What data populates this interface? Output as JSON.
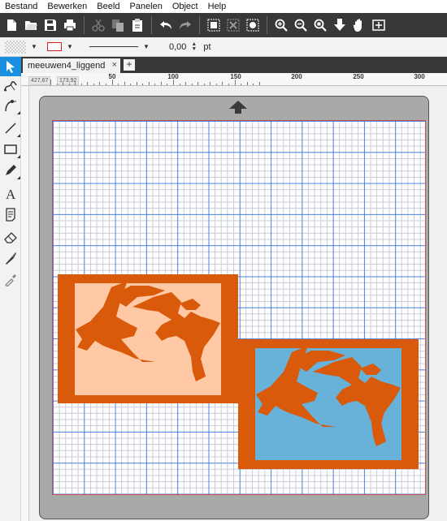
{
  "menubar": {
    "items": [
      "Bestand",
      "Bewerken",
      "Beeld",
      "Panelen",
      "Object",
      "Help"
    ]
  },
  "toolbar": {
    "buttons": [
      {
        "icon": "new-document-icon"
      },
      {
        "icon": "open-folder-icon"
      },
      {
        "icon": "save-icon"
      },
      {
        "icon": "print-icon"
      },
      {
        "icon": "cut-icon"
      },
      {
        "icon": "copy-icon"
      },
      {
        "icon": "paste-icon"
      },
      {
        "icon": "undo-icon"
      },
      {
        "icon": "redo-icon"
      },
      {
        "icon": "group-icon"
      },
      {
        "icon": "ungroup-icon"
      },
      {
        "icon": "trace-image-icon"
      },
      {
        "icon": "zoom-in-icon"
      },
      {
        "icon": "zoom-out-icon"
      },
      {
        "icon": "zoom-selection-icon"
      },
      {
        "icon": "send-to-cutter-icon"
      },
      {
        "icon": "pan-hand-icon"
      },
      {
        "icon": "fit-page-icon"
      }
    ],
    "colors": {
      "background": "#383838",
      "icon": "#ffffff"
    }
  },
  "options": {
    "stroke_width": "0,00",
    "unit": "pt",
    "stroke_color": "#e02020"
  },
  "document": {
    "tab_label": "meeuwen4_liggend",
    "close_glyph": "×",
    "add_glyph": "+"
  },
  "ruler": {
    "labels": [
      "50",
      "100",
      "150",
      "200",
      "250",
      "300"
    ],
    "cursor_x": "427,67",
    "cursor_y": "173,92"
  },
  "tools": [
    {
      "icon": "select-arrow-icon",
      "active": true
    },
    {
      "icon": "node-edit-icon"
    },
    {
      "icon": "bezier-pen-icon"
    },
    {
      "icon": "line-tool-icon"
    },
    {
      "icon": "rectangle-tool-icon"
    },
    {
      "icon": "pencil-tool-icon"
    },
    {
      "icon": "text-tool-icon"
    },
    {
      "icon": "text-on-path-icon"
    },
    {
      "icon": "eraser-tool-icon"
    },
    {
      "icon": "knife-tool-icon"
    },
    {
      "icon": "eyedropper-tool-icon"
    }
  ],
  "canvas": {
    "colors": {
      "frame": "#d85a0a",
      "design1_bg": "#ffc9a6",
      "design2_bg": "#68b1d8",
      "silhouette": "#d85a0a",
      "grid_major": "#3f7fe0",
      "mat": "#a8aaaa"
    }
  }
}
